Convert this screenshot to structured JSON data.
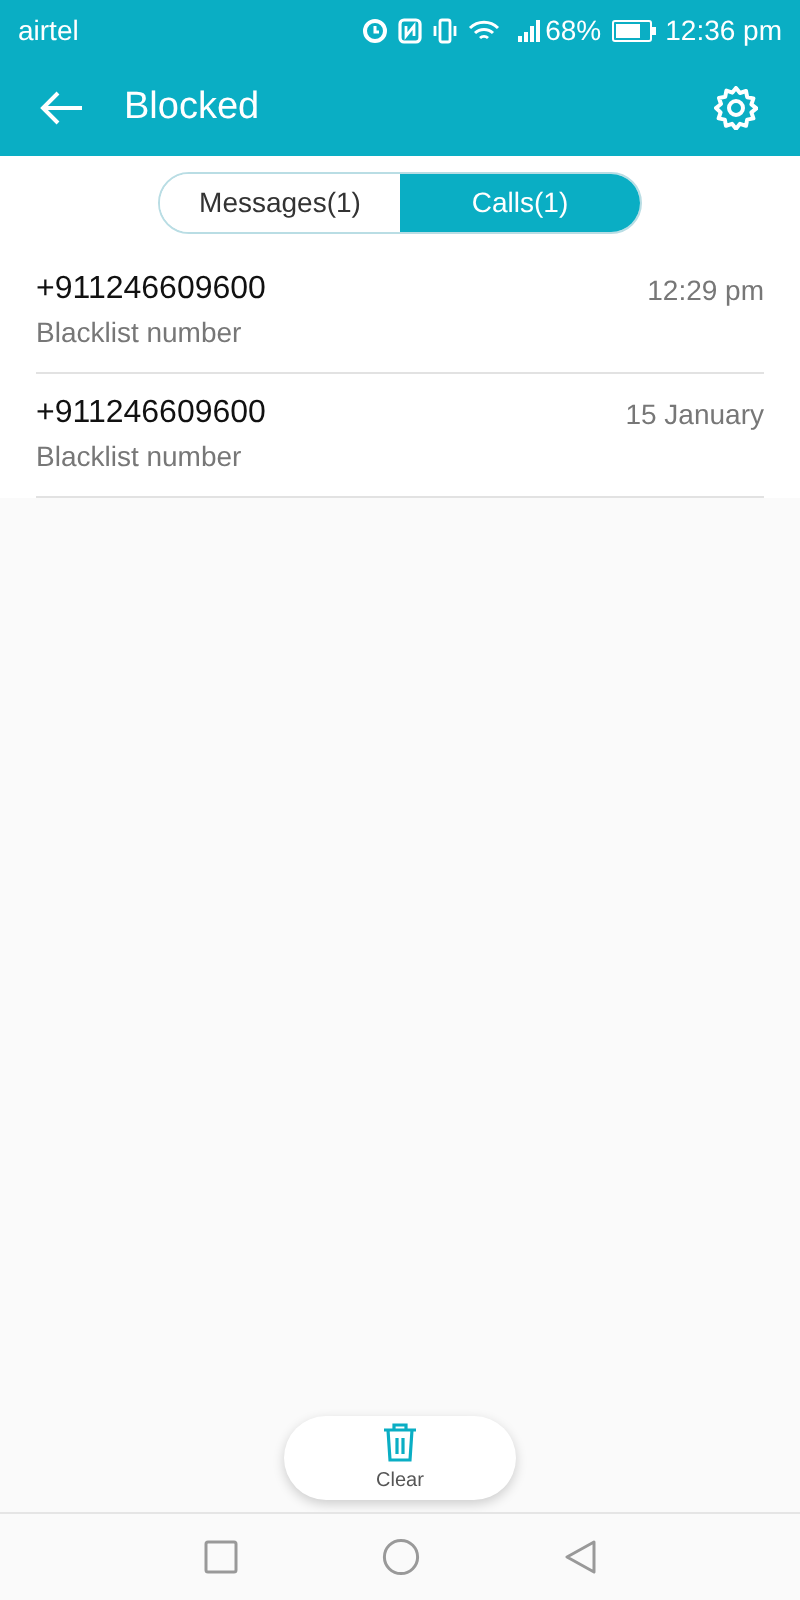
{
  "status_bar": {
    "carrier": "airtel",
    "battery_text": "68%",
    "time": "12:36 pm"
  },
  "header": {
    "title": "Blocked"
  },
  "tabs": [
    {
      "label": "Messages(1)",
      "selected": false
    },
    {
      "label": "Calls(1)",
      "selected": true
    }
  ],
  "calls": [
    {
      "number": "+911246609600",
      "label": "Blacklist number",
      "time": "12:29 pm"
    },
    {
      "number": "+911246609600",
      "label": "Blacklist number",
      "time": "15 January"
    }
  ],
  "clear_button": {
    "label": "Clear"
  }
}
